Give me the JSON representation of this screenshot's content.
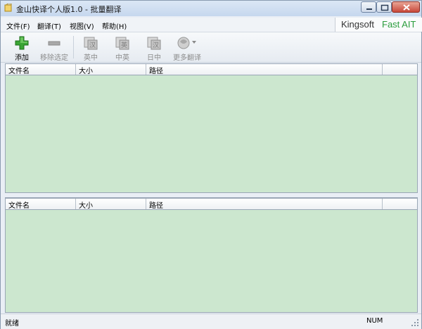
{
  "window": {
    "title": "金山快译个人版1.0 - 批量翻译"
  },
  "menu": {
    "items": [
      "文件(F)",
      "翻译(T)",
      "视图(V)",
      "帮助(H)"
    ]
  },
  "brand": {
    "kingsoft": "Kingsoft",
    "fast": "Fast AIT"
  },
  "toolbar": {
    "buttons": [
      {
        "label": "添加",
        "icon": "add-plus-icon",
        "enabled": true
      },
      {
        "label": "移除选定",
        "icon": "remove-minus-icon",
        "enabled": false
      },
      {
        "label": "英中",
        "icon": "en-cn-translate-icon",
        "enabled": false
      },
      {
        "label": "中英",
        "icon": "cn-en-translate-icon",
        "enabled": false
      },
      {
        "label": "日中",
        "icon": "jp-cn-translate-icon",
        "enabled": false
      },
      {
        "label": "更多翻译",
        "icon": "more-translate-icon",
        "enabled": false
      }
    ]
  },
  "top_list": {
    "columns": [
      "文件名",
      "大小",
      "路径",
      ""
    ]
  },
  "bottom_list": {
    "columns": [
      "文件名",
      "大小",
      "路径",
      ""
    ]
  },
  "status": {
    "text": "就绪",
    "num": "NUM"
  },
  "colors": {
    "list_background": "#cce7cf",
    "brand_green": "#2a9d3c",
    "add_icon_green": "#3aa534"
  }
}
